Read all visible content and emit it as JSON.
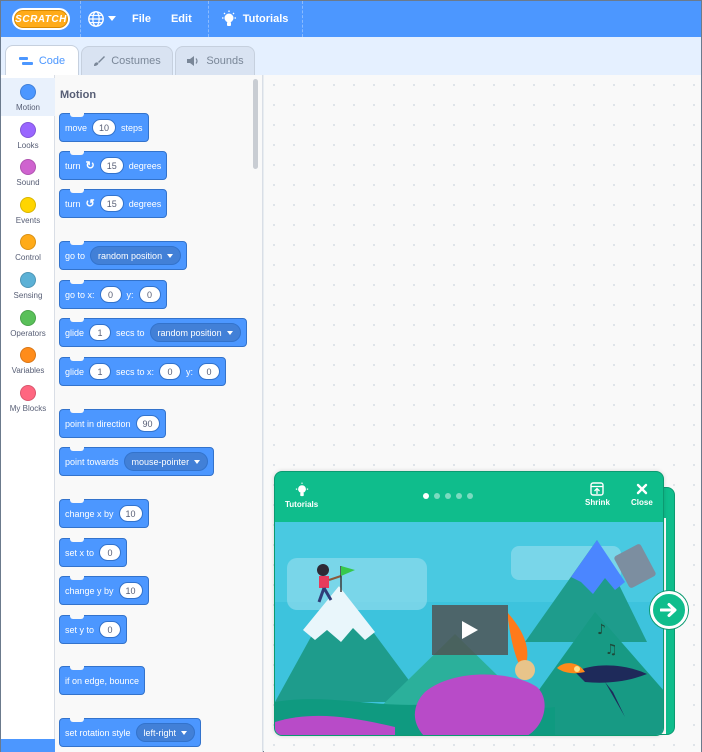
{
  "menubar": {
    "logo": "SCRATCH",
    "file": "File",
    "edit": "Edit",
    "tutorials": "Tutorials"
  },
  "tabs": [
    {
      "label": "Code",
      "icon": "code-icon",
      "active": true
    },
    {
      "label": "Costumes",
      "icon": "brush-icon",
      "active": false
    },
    {
      "label": "Sounds",
      "icon": "speaker-icon",
      "active": false
    }
  ],
  "categories": [
    {
      "label": "Motion",
      "color": "#4c97ff"
    },
    {
      "label": "Looks",
      "color": "#9966ff"
    },
    {
      "label": "Sound",
      "color": "#cf63cf"
    },
    {
      "label": "Events",
      "color": "#ffd500"
    },
    {
      "label": "Control",
      "color": "#ffab19"
    },
    {
      "label": "Sensing",
      "color": "#5cb1d6"
    },
    {
      "label": "Operators",
      "color": "#59c059"
    },
    {
      "label": "Variables",
      "color": "#ff8c1a"
    },
    {
      "label": "My Blocks",
      "color": "#ff6680"
    }
  ],
  "palette": {
    "title": "Motion",
    "blocks": {
      "move": {
        "t1": "move",
        "v1": "10",
        "t2": "steps"
      },
      "turn_right": {
        "t1": "turn",
        "v1": "15",
        "t2": "degrees"
      },
      "turn_left": {
        "t1": "turn",
        "v1": "15",
        "t2": "degrees"
      },
      "go_to": {
        "t1": "go to",
        "d1": "random position"
      },
      "go_to_xy": {
        "t1": "go to x:",
        "v1": "0",
        "t2": "y:",
        "v2": "0"
      },
      "glide_to": {
        "t1": "glide",
        "v1": "1",
        "t2": "secs to",
        "d1": "random position"
      },
      "glide_xy": {
        "t1": "glide",
        "v1": "1",
        "t2": "secs to x:",
        "v2": "0",
        "t3": "y:",
        "v3": "0"
      },
      "point_dir": {
        "t1": "point in direction",
        "v1": "90"
      },
      "point_towards": {
        "t1": "point towards",
        "d1": "mouse-pointer"
      },
      "change_x": {
        "t1": "change x by",
        "v1": "10"
      },
      "set_x": {
        "t1": "set x to",
        "v1": "0"
      },
      "change_y": {
        "t1": "change y by",
        "v1": "10"
      },
      "set_y": {
        "t1": "set y to",
        "v1": "0"
      },
      "bounce": {
        "t1": "if on edge, bounce"
      },
      "rotation": {
        "t1": "set rotation style",
        "d1": "left-right"
      }
    }
  },
  "tutorial_card": {
    "tutorials_label": "Tutorials",
    "shrink_label": "Shrink",
    "close_label": "Close",
    "steps_total": 5,
    "active_step": 1
  },
  "colors": {
    "menubar": "#4c97ff",
    "motion": "#4c97ff",
    "tutorial": "#0fbd8c"
  }
}
